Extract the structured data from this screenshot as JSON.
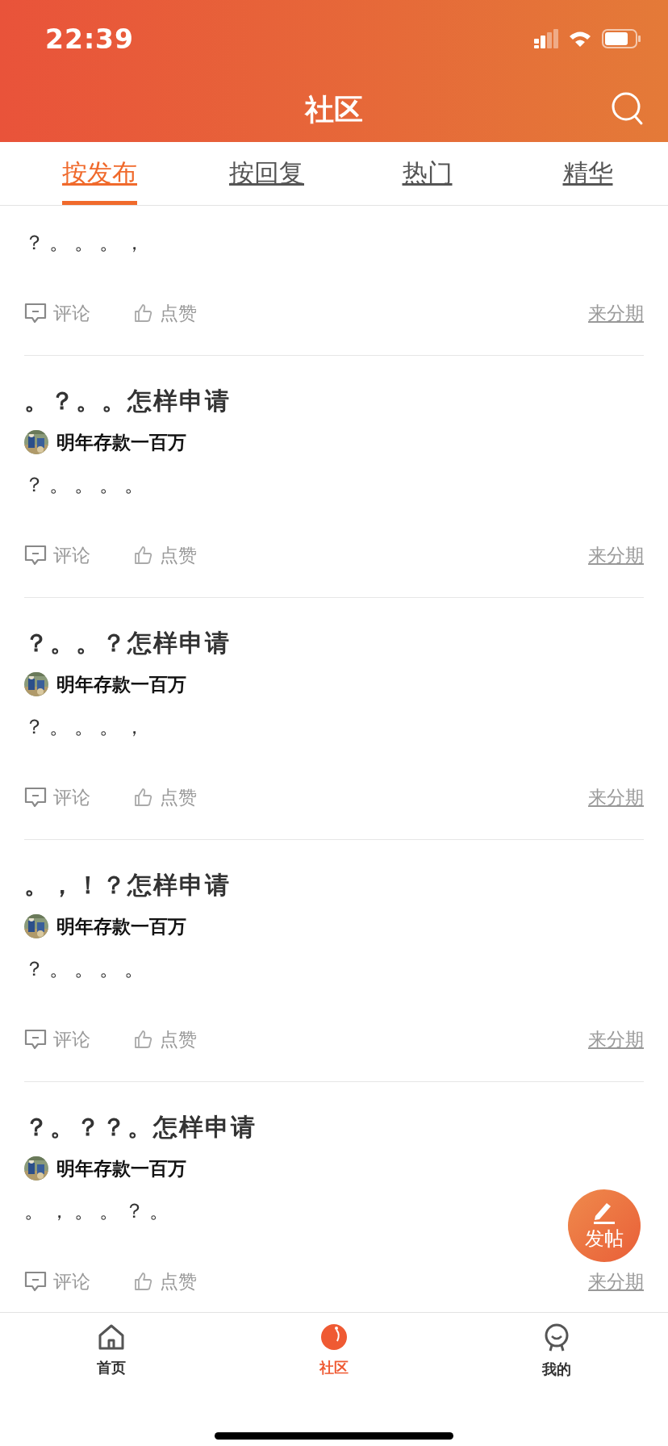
{
  "status_bar": {
    "time": "22:39"
  },
  "header": {
    "title": "社区"
  },
  "tabs": [
    {
      "label": "按发布",
      "selected": true
    },
    {
      "label": "按回复",
      "selected": false
    },
    {
      "label": "热门",
      "selected": false
    },
    {
      "label": "精华",
      "selected": false
    }
  ],
  "posts": [
    {
      "body": "？。。。，",
      "comment": "评论",
      "like": "点赞",
      "tag": "来分期"
    },
    {
      "title": "。？。。怎样申请",
      "author": "明年存款一百万",
      "body": "？。。。。",
      "comment": "评论",
      "like": "点赞",
      "tag": "来分期"
    },
    {
      "title": "？。。？怎样申请",
      "author": "明年存款一百万",
      "body": "？。。。，",
      "comment": "评论",
      "like": "点赞",
      "tag": "来分期"
    },
    {
      "title": "。，！？怎样申请",
      "author": "明年存款一百万",
      "body": "？。。。。",
      "comment": "评论",
      "like": "点赞",
      "tag": "来分期"
    },
    {
      "title": "？。？？。怎样申请",
      "author": "明年存款一百万",
      "body": "。，。。？。",
      "comment": "评论",
      "like": "点赞",
      "tag": "来分期"
    }
  ],
  "fab": {
    "label": "发帖"
  },
  "bottom_nav": [
    {
      "label": "首页",
      "selected": false
    },
    {
      "label": "社区",
      "selected": true
    },
    {
      "label": "我的",
      "selected": false
    }
  ]
}
